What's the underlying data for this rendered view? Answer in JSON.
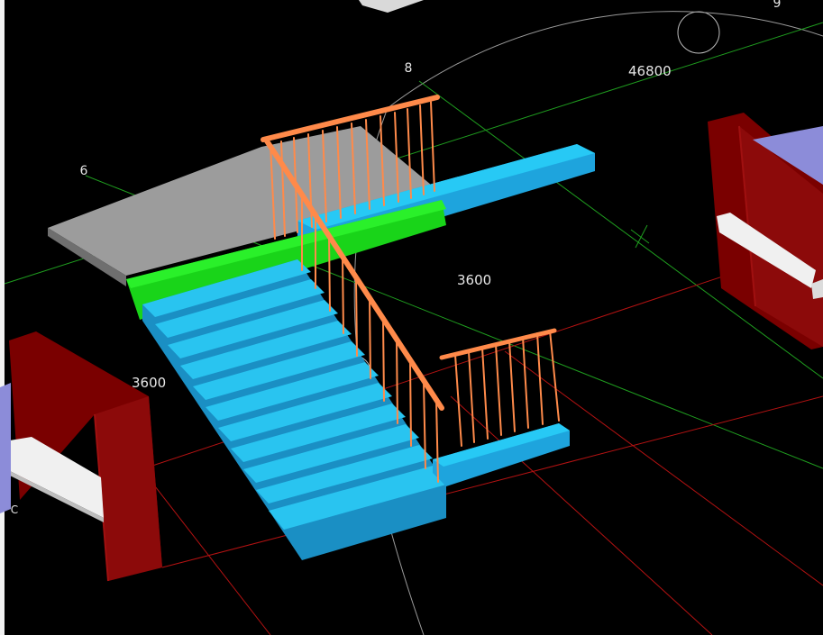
{
  "viewport": {
    "background": "#000000",
    "dimension_labels": {
      "overall_length": "46800",
      "landing_width": "3600",
      "flight_width": "3600"
    },
    "axis_tags": {
      "a6": "6",
      "a8": "8",
      "a9": "9",
      "c": "C"
    },
    "colors": {
      "grid_green": "#1f9d1f",
      "grid_red": "#b31212",
      "stair_blue": "#1ea4dd",
      "stair_blue_light": "#27c9f5",
      "handrail_orange": "#ff8a4a",
      "landing_grey": "#9c9c9c",
      "beam_green": "#19d419",
      "door_maroon": "#7a0000",
      "window_lavender": "#8c8cd9"
    },
    "icons": [
      "snap-target-icon",
      "compass-circle-icon"
    ]
  }
}
